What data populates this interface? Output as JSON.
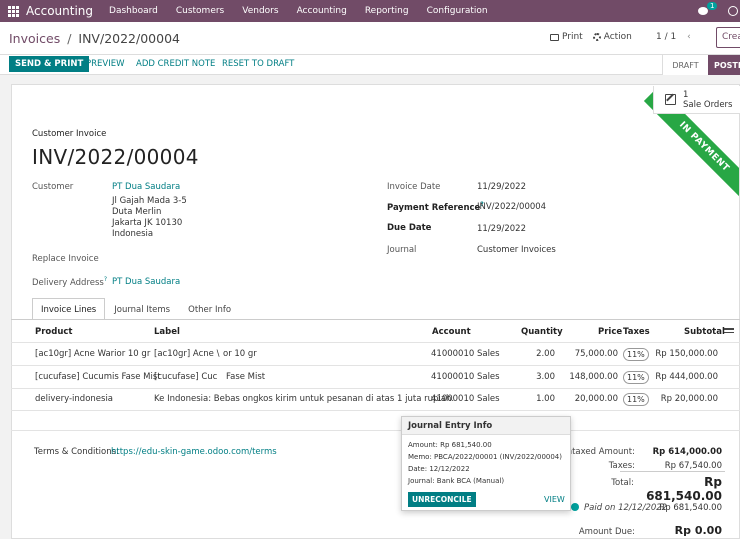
{
  "navbar": {
    "brand": "Accounting",
    "menu": [
      "Dashboard",
      "Customers",
      "Vendors",
      "Accounting",
      "Reporting",
      "Configuration"
    ],
    "chat_badge": "1",
    "bg_color": "#714b67"
  },
  "control": {
    "breadcrumb_parent": "Invoices",
    "breadcrumb_separator": "/",
    "breadcrumb_current": "INV/2022/00004",
    "print_label": "Print",
    "action_label": "Action",
    "pager": "1 / 1",
    "create_label": "Crea"
  },
  "statusbar": {
    "send_print": "SEND & PRINT",
    "preview": "PREVIEW",
    "add_credit_note": "ADD CREDIT NOTE",
    "reset_to_draft": "RESET TO DRAFT",
    "stage_draft": "DRAFT",
    "stage_posted": "POSTED"
  },
  "smart_button": {
    "count": "1",
    "label": "Sale Orders"
  },
  "ribbon": "IN PAYMENT",
  "invoice": {
    "type": "Customer Invoice",
    "name": "INV/2022/00004",
    "customer_label": "Customer",
    "customer_name": "PT Dua Saudara",
    "address_lines": [
      "Jl Gajah Mada 3-5",
      "Duta Merlin",
      "Jakarta JK 10130",
      "Indonesia"
    ],
    "replace_invoice_label": "Replace Invoice",
    "delivery_label": "Delivery Address",
    "delivery_value": "PT Dua Saudara",
    "invoice_date_label": "Invoice Date",
    "invoice_date": "11/29/2022",
    "payment_ref_label": "Payment Reference",
    "payment_ref": "INV/2022/00004",
    "due_date_label": "Due Date",
    "due_date": "11/29/2022",
    "journal_label": "Journal",
    "journal": "Customer Invoices",
    "help_mark": "?"
  },
  "tabs": [
    "Invoice Lines",
    "Journal Items",
    "Other Info"
  ],
  "table": {
    "headers": [
      "Product",
      "Label",
      "Account",
      "Quantity",
      "Price",
      "Taxes",
      "Subtotal"
    ],
    "rows": [
      {
        "product": "[ac10gr] Acne Warior 10 gr",
        "label_a": "[ac10gr] Acne \\",
        "label_b": "or 10 gr",
        "account": "41000010 Sales",
        "quantity": "2.00",
        "price": "75,000.00",
        "taxes": "11%",
        "subtotal": "Rp 150,000.00"
      },
      {
        "product": "[cucufase] Cucumis Fase Mist",
        "label_a": "[cucufase] Cuc",
        "label_b": "Fase Mist",
        "account": "41000010 Sales",
        "quantity": "3.00",
        "price": "148,000.00",
        "taxes": "11%",
        "subtotal": "Rp 444,000.00"
      },
      {
        "product": "delivery-indonesia",
        "label_a": "Ke Indonesia: Bebas ongkos kirim untuk pesanan di atas 1 juta rupiah.",
        "label_b": "",
        "account": "41000010 Sales",
        "quantity": "1.00",
        "price": "20,000.00",
        "taxes": "11%",
        "subtotal": "Rp 20,000.00"
      }
    ]
  },
  "terms": {
    "label": "Terms & Conditions:",
    "link": "https://edu-skin-game.odoo.com/terms"
  },
  "totals": {
    "untaxed_label": "Untaxed Amount:",
    "untaxed": "Rp 614,000.00",
    "taxes_label": "Taxes:",
    "taxes": "Rp 67,540.00",
    "total_label": "Total:",
    "total": "Rp 681,540.00",
    "paid_label": "Paid on 12/12/2022",
    "paid_amount": "Rp 681,540.00",
    "amount_due_label": "Amount Due:",
    "amount_due": "Rp 0.00"
  },
  "popover": {
    "title": "Journal Entry Info",
    "amount": "Amount: Rp 681,540.00",
    "memo": "Memo:    PBCA/2022/00001 (INV/2022/00004)",
    "date": "Date:      12/12/2022",
    "journal": "Journal:  Bank BCA (Manual)",
    "unreconcile": "UNRECONCILE",
    "view": "VIEW"
  }
}
